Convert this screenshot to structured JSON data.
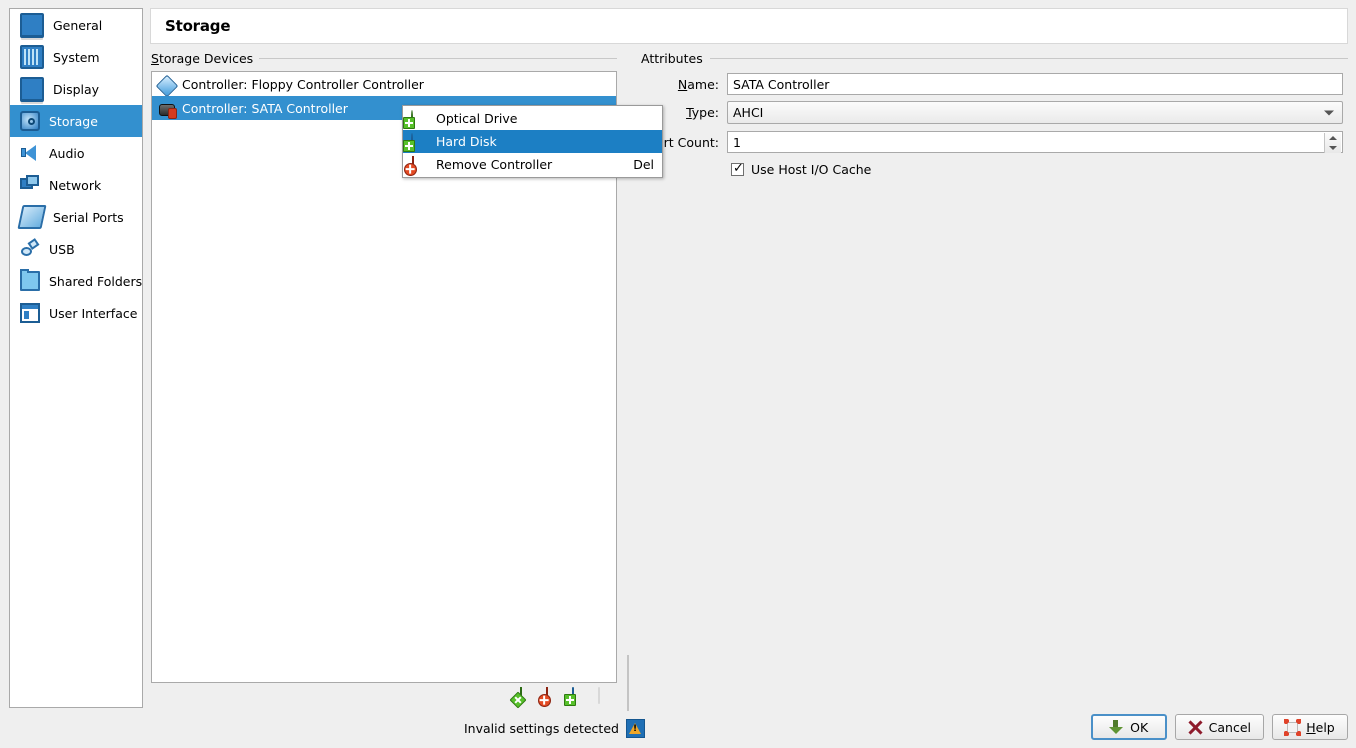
{
  "window": {
    "header_title": "Storage"
  },
  "sidebar": {
    "items": [
      {
        "label": "General",
        "icon": "monitor-icon"
      },
      {
        "label": "System",
        "icon": "system-chip-icon"
      },
      {
        "label": "Display",
        "icon": "display-icon"
      },
      {
        "label": "Storage",
        "icon": "storage-disk-icon"
      },
      {
        "label": "Audio",
        "icon": "speaker-icon"
      },
      {
        "label": "Network",
        "icon": "network-icon"
      },
      {
        "label": "Serial Ports",
        "icon": "serial-port-icon"
      },
      {
        "label": "USB",
        "icon": "usb-icon"
      },
      {
        "label": "Shared Folders",
        "icon": "folder-icon"
      },
      {
        "label": "User Interface",
        "icon": "user-interface-icon"
      }
    ],
    "selected_index": 3
  },
  "storage_devices": {
    "group_title": "Storage Devices",
    "group_title_accesskey": "S",
    "rows": [
      {
        "label": "Controller: Floppy Controller Controller",
        "icon": "floppy-controller-icon",
        "selected": false
      },
      {
        "label": "Controller: SATA Controller",
        "icon": "sata-controller-icon",
        "selected": true
      }
    ],
    "toolbar": [
      {
        "name": "add-controller",
        "icon": "green-diamond-plus-icon",
        "enabled": true
      },
      {
        "name": "remove-controller",
        "icon": "red-diamond-x-icon",
        "enabled": true
      },
      {
        "name": "add-attachment",
        "icon": "blue-square-plus-icon",
        "enabled": true
      },
      {
        "name": "remove-attachment",
        "icon": "gray-square-x-icon",
        "enabled": false
      }
    ]
  },
  "attributes": {
    "group_title": "Attributes",
    "name_label": "Name:",
    "name_accesskey": "N",
    "name_value": "SATA Controller",
    "type_label": "Type:",
    "type_accesskey": "T",
    "type_value": "AHCI",
    "port_count_label": "Port Count:",
    "port_count_accesskey": "P",
    "port_count_value": "1",
    "host_io_cache_label": "Use Host I/O Cache",
    "host_io_cache_checked": true
  },
  "context_menu": {
    "items": [
      {
        "label": "Optical Drive",
        "icon": "optical-drive-add-icon",
        "shortcut": "",
        "active": false
      },
      {
        "label": "Hard Disk",
        "icon": "hard-disk-add-icon",
        "shortcut": "",
        "active": true
      },
      {
        "label": "Remove Controller",
        "icon": "remove-controller-icon",
        "shortcut": "Del",
        "active": false
      }
    ]
  },
  "status": {
    "text": "Invalid settings detected",
    "icon": "warning-icon"
  },
  "footer_buttons": [
    {
      "label": "OK",
      "icon": "green-arrow-icon",
      "default": true
    },
    {
      "label": "Cancel",
      "icon": "red-x-icon",
      "default": false
    },
    {
      "label": "Help",
      "icon": "help-icon",
      "default": false,
      "accesskey": "H"
    }
  ],
  "colors": {
    "selection_blue": "#3390cf",
    "menu_highlight": "#1c7fc4",
    "window_bg": "#efefef"
  }
}
